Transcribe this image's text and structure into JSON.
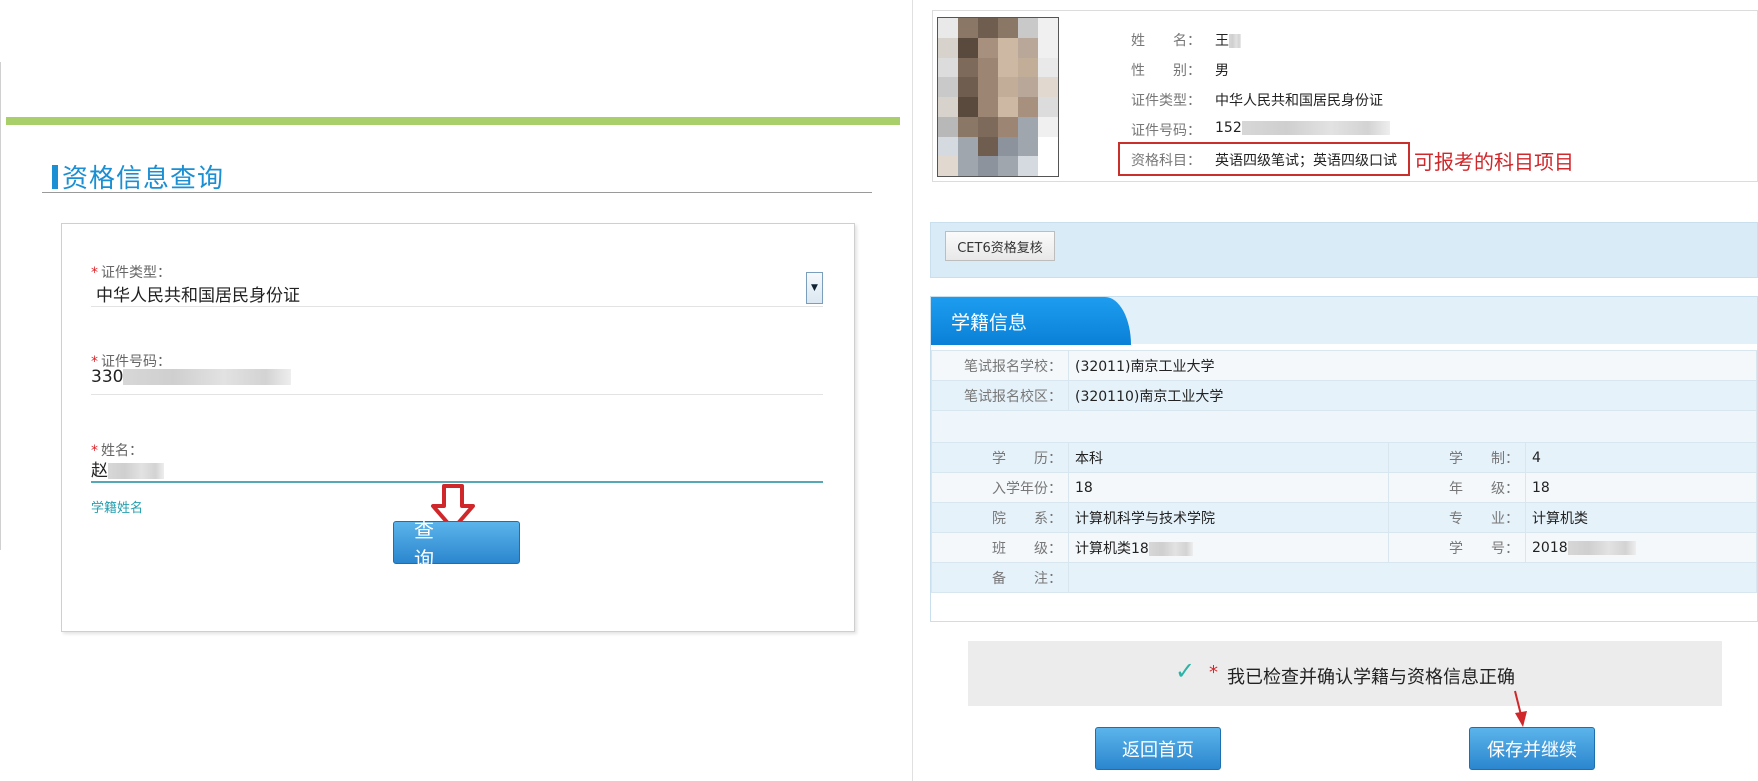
{
  "query_form": {
    "title": "资格信息查询",
    "id_type": {
      "label": "证件类型：",
      "value": "中华人民共和国居民身份证"
    },
    "id_number": {
      "label": "证件号码：",
      "value_prefix": "330"
    },
    "name": {
      "label": "姓名：",
      "value_prefix": "赵"
    },
    "name_hint": "学籍姓名",
    "query_button": "查　询"
  },
  "candidate": {
    "name_label": "姓　　名：",
    "name_value": "王",
    "gender_label": "性　　别：",
    "gender_value": "男",
    "id_type_label": "证件类型：",
    "id_type_value": "中华人民共和国居民身份证",
    "id_number_label": "证件号码：",
    "id_number_value": "152",
    "subjects_label": "资格科目：",
    "subjects_value": "英语四级笔试；英语四级口试",
    "annotation": "可报考的科目项目"
  },
  "cet6_button": "CET6资格复核",
  "student_info": {
    "section_title": "学籍信息",
    "exam_school_label": "笔试报名学校：",
    "exam_school_value": "(32011)南京工业大学",
    "exam_campus_label": "笔试报名校区：",
    "exam_campus_value": "(320110)南京工业大学",
    "education_label": "学　　历：",
    "education_value": "本科",
    "duration_label": "学　　制：",
    "duration_value": "4",
    "enroll_year_label": "入学年份：",
    "enroll_year_value": "18",
    "grade_label": "年　　级：",
    "grade_value": "18",
    "faculty_label": "院　　系：",
    "faculty_value": "计算机科学与技术学院",
    "major_label": "专　　业：",
    "major_value": "计算机类",
    "class_label": "班　　级：",
    "class_value": "计算机类18",
    "student_no_label": "学　　号：",
    "student_no_value": "2018",
    "remark_label": "备　　注：",
    "remark_value": ""
  },
  "confirm": {
    "required_mark": "*",
    "text": "我已检查并确认学籍与资格信息正确"
  },
  "buttons": {
    "home": "返回首页",
    "save_continue": "保存并继续"
  },
  "colors": {
    "accent_blue": "#1a8fd3",
    "green_bar": "#a9cf6b",
    "annotation_red": "#d0272b",
    "tab_blue": "#0a80d6"
  }
}
